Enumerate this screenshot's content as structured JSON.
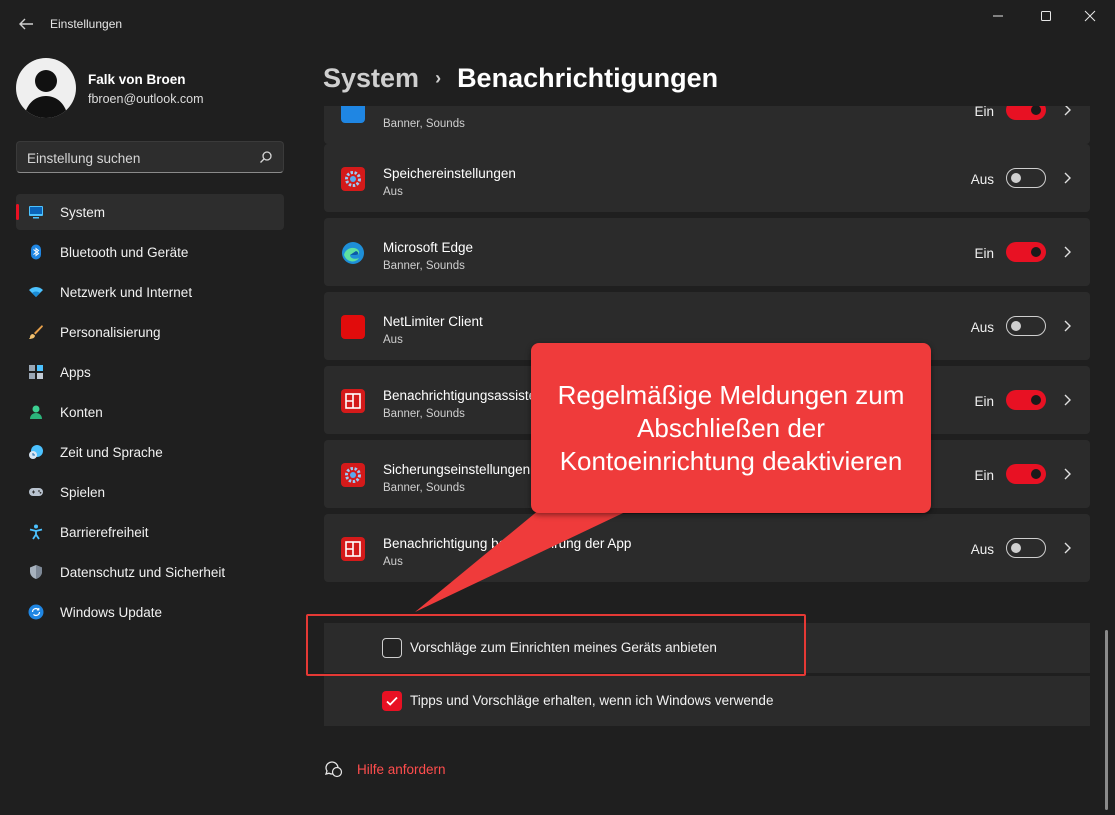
{
  "window": {
    "title": "Einstellungen"
  },
  "user": {
    "name": "Falk von Broen",
    "email": "fbroen@outlook.com"
  },
  "search": {
    "placeholder": "Einstellung suchen"
  },
  "sidebar": {
    "items": [
      {
        "label": "System",
        "icon": "monitor-icon",
        "active": true
      },
      {
        "label": "Bluetooth und Geräte",
        "icon": "bluetooth-icon"
      },
      {
        "label": "Netzwerk und Internet",
        "icon": "wifi-icon"
      },
      {
        "label": "Personalisierung",
        "icon": "brush-icon"
      },
      {
        "label": "Apps",
        "icon": "apps-icon"
      },
      {
        "label": "Konten",
        "icon": "person-icon"
      },
      {
        "label": "Zeit und Sprache",
        "icon": "clock-globe-icon"
      },
      {
        "label": "Spielen",
        "icon": "gamepad-icon"
      },
      {
        "label": "Barrierefreiheit",
        "icon": "accessibility-icon"
      },
      {
        "label": "Datenschutz und Sicherheit",
        "icon": "shield-icon"
      },
      {
        "label": "Windows Update",
        "icon": "update-icon"
      }
    ]
  },
  "header": {
    "parent": "System",
    "separator": "›",
    "current": "Benachrichtigungen"
  },
  "apps": [
    {
      "name": "",
      "sub": "Banner, Sounds",
      "state": "Ein",
      "on": true,
      "icon": "blue-app-icon"
    },
    {
      "name": "Speichereinstellungen",
      "sub": "Aus",
      "state": "Aus",
      "on": false,
      "icon": "gear-app-icon"
    },
    {
      "name": "Microsoft Edge",
      "sub": "Banner, Sounds",
      "state": "Ein",
      "on": true,
      "icon": "edge-icon"
    },
    {
      "name": "NetLimiter Client",
      "sub": "Aus",
      "state": "Aus",
      "on": false,
      "icon": "netlimiter-icon"
    },
    {
      "name": "Benachrichtigungsassistent",
      "sub": "Banner, Sounds",
      "state": "Ein",
      "on": true,
      "icon": "grid-app-icon"
    },
    {
      "name": "Sicherungseinstellungen",
      "sub": "Banner, Sounds",
      "state": "Ein",
      "on": true,
      "icon": "gear-app-icon"
    },
    {
      "name": "Benachrichtigung bei Ausführung der App",
      "sub": "Aus",
      "state": "Aus",
      "on": false,
      "icon": "grid-app-icon"
    }
  ],
  "checkboxes": [
    {
      "label": "Vorschläge zum Einrichten meines Geräts anbieten",
      "checked": false
    },
    {
      "label": "Tipps und Vorschläge erhalten, wenn ich Windows verwende",
      "checked": true
    }
  ],
  "help": {
    "label": "Hilfe anfordern"
  },
  "callout": {
    "text": "Regelmäßige Meldungen zum Abschließen der Kontoeinrichtung deaktivieren"
  },
  "colors": {
    "accent": "#e81123",
    "callout": "#ef3b3b",
    "background": "#1f1f1f",
    "card": "#2b2b2b"
  }
}
